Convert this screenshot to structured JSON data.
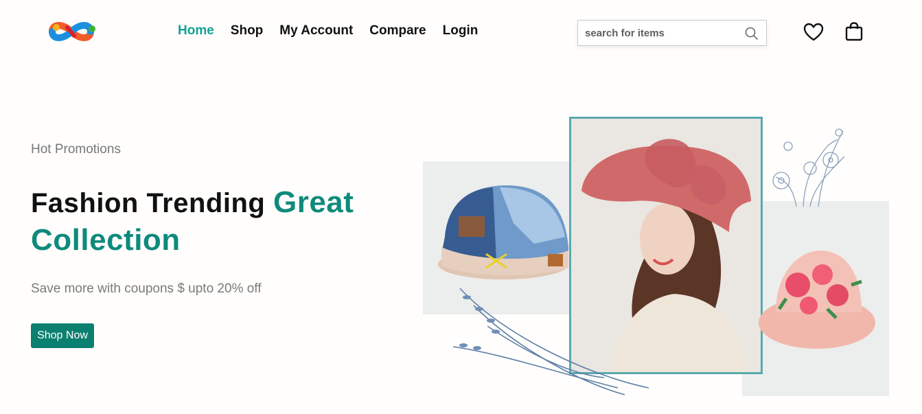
{
  "header": {
    "logo_icon": "infinity-logo-icon",
    "nav": [
      {
        "label": "Home",
        "active": true
      },
      {
        "label": "Shop",
        "active": false
      },
      {
        "label": "My Account",
        "active": false
      },
      {
        "label": "Compare",
        "active": false
      },
      {
        "label": "Login",
        "active": false
      }
    ],
    "search": {
      "placeholder": "search for items",
      "value": "",
      "icon": "search-icon"
    },
    "wishlist_icon": "heart-icon",
    "cart_icon": "shopping-bag-icon"
  },
  "hero": {
    "subtitle": "Hot Promotions",
    "title_plain": "Fashion Trending",
    "title_accent": "Great Collection",
    "description": "Save more with coupons $ upto 20% off",
    "cta_label": "Shop Now"
  },
  "colors": {
    "accent": "#0f8a7c",
    "nav_active": "#15a094",
    "button_bg": "#0c8070",
    "frame_border": "#5aa9ad",
    "background": "#fffefc"
  }
}
